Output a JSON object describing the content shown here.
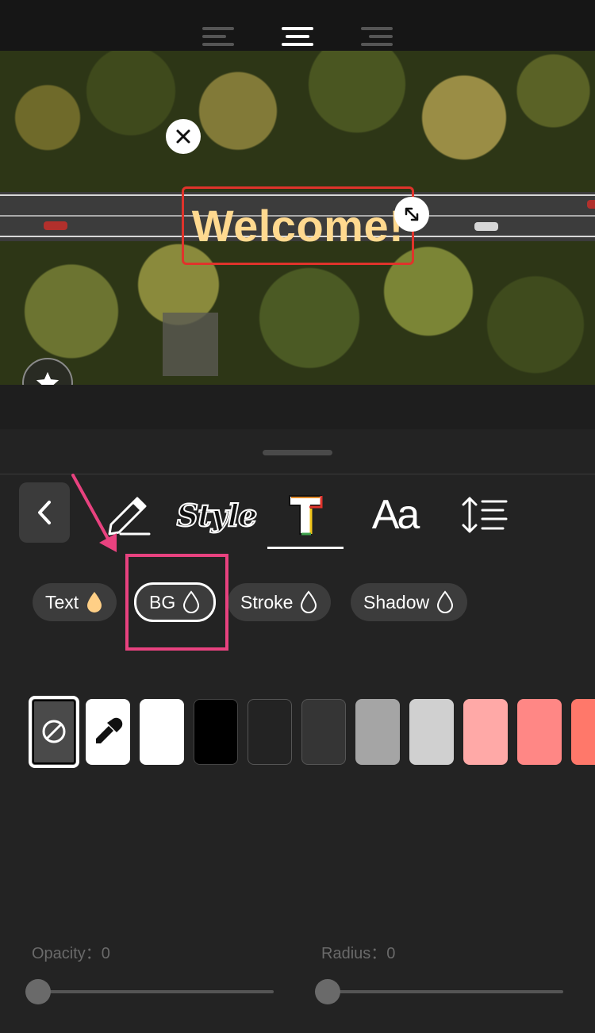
{
  "alignment": {
    "options": [
      "align-left",
      "align-center",
      "align-right"
    ],
    "selected": "align-center"
  },
  "preview": {
    "overlay_text": "Welcome!",
    "overlay_text_color": "#ffd98f",
    "selection_color": "#e0332b"
  },
  "toolbar": {
    "tools": [
      "edit-pencil-icon",
      "style-preset",
      "text-color",
      "font",
      "spacing"
    ],
    "style_label": "Style",
    "font_label": "Aa",
    "active_tool": "text-color"
  },
  "color_targets": [
    {
      "label": "Text",
      "drop_color": "#ffcf86",
      "active": false
    },
    {
      "label": "BG",
      "drop_color": "none",
      "active": true
    },
    {
      "label": "Stroke",
      "drop_color": "none",
      "active": false
    },
    {
      "label": "Shadow",
      "drop_color": "none",
      "active": false
    }
  ],
  "swatches": [
    "none",
    "eyedropper",
    "#ffffff",
    "#000000",
    "#232323",
    "#353535",
    "#a5a5a5",
    "#d0d0d0",
    "#ffa9a7",
    "#ff8785",
    "#ff786a"
  ],
  "sliders": {
    "opacity_label": "Opacity：0",
    "opacity_value": 0,
    "radius_label": "Radius：0",
    "radius_value": 0
  },
  "annotation_color": "#e8427f"
}
